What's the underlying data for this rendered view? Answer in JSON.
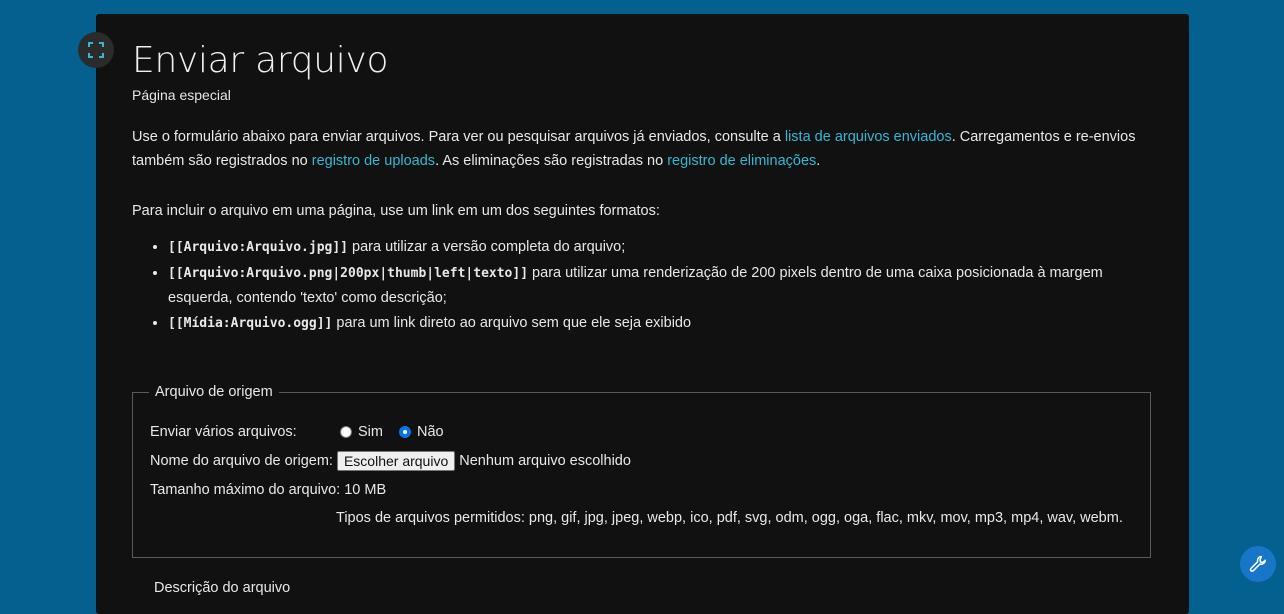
{
  "header": {
    "title": "Enviar arquivo",
    "subtitle": "Página especial"
  },
  "intro": {
    "text1": "Use o formulário abaixo para enviar arquivos. Para ver ou pesquisar arquivos já enviados, consulte a ",
    "link1": "lista de arquivos enviados",
    "text2": ". Carregamentos e re-envios também são registrados no ",
    "link2": "registro de uploads",
    "text3": ". As eliminações são registradas no ",
    "link3": "registro de eliminações",
    "text4": "."
  },
  "formats": {
    "intro": "Para incluir o arquivo em uma página, use um link em um dos seguintes formatos:",
    "items": [
      {
        "code": "[[Arquivo:Arquivo.jpg]]",
        "text": " para utilizar a versão completa do arquivo;"
      },
      {
        "code": "[[Arquivo:Arquivo.png|200px|thumb|left|texto]]",
        "text": " para utilizar uma renderização de 200 pixels dentro de uma caixa posicionada à margem esquerda, contendo 'texto' como descrição;"
      },
      {
        "code": "[[Mídia:Arquivo.ogg]]",
        "text": " para um link direto ao arquivo sem que ele seja exibido"
      }
    ]
  },
  "source_form": {
    "legend": "Arquivo de origem",
    "multi_label": "Enviar vários arquivos:",
    "option_yes": "Sim",
    "option_no": "Não",
    "selected": "Não",
    "file_label": "Nome do arquivo de origem:",
    "file_button": "Escolher arquivo",
    "file_status": "Nenhum arquivo escolhido",
    "max_size": "Tamanho máximo do arquivo: 10 MB",
    "allowed_types": "Tipos de arquivos permitidos: png, gif, jpg, jpeg, webp, ico, pdf, svg, odm, ogg, oga, flac, mkv, mov, mp3, mp4, wav, webm."
  },
  "description_form": {
    "legend": "Descrição do arquivo"
  },
  "colors": {
    "background": "#04608f",
    "panel": "#111111",
    "link": "#36b7d6",
    "tool_button": "#1776c7"
  },
  "icons": {
    "fullscreen": "expand-icon",
    "tools": "wrench-icon"
  }
}
